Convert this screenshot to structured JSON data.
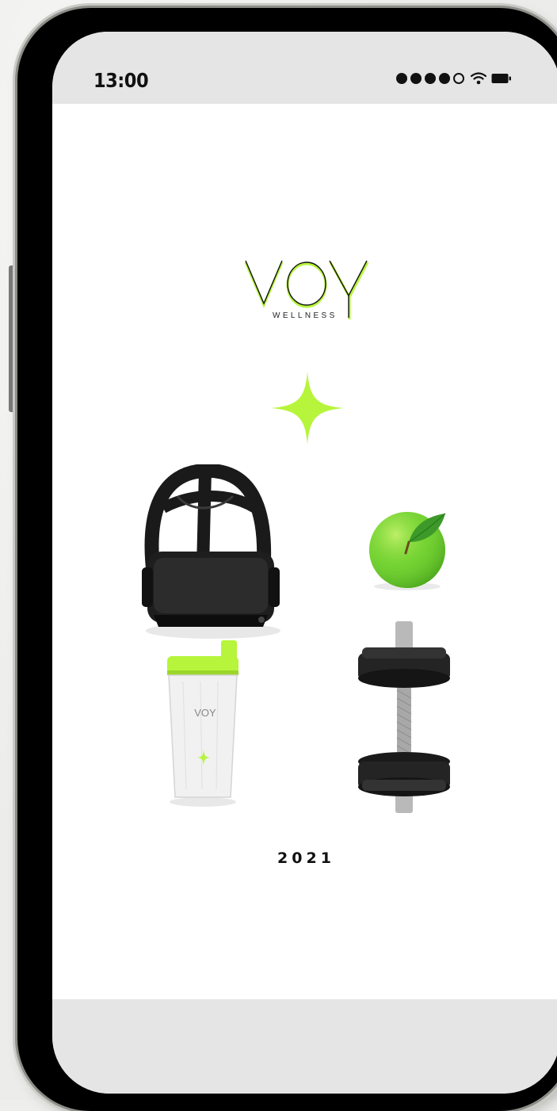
{
  "status_bar": {
    "time": "13:00",
    "signal_icon": "signal-dots-icon",
    "wifi_icon": "wifi-icon",
    "battery_icon": "battery-icon"
  },
  "brand": {
    "logo_text": "VOY",
    "logo_subtext": "WELLNESS",
    "accent_color": "#b6f53b"
  },
  "illustrations": [
    "vr-headset",
    "green-apple",
    "shaker-bottle",
    "dumbbell"
  ],
  "bottle_logo_text": "VOY",
  "year": "2021"
}
